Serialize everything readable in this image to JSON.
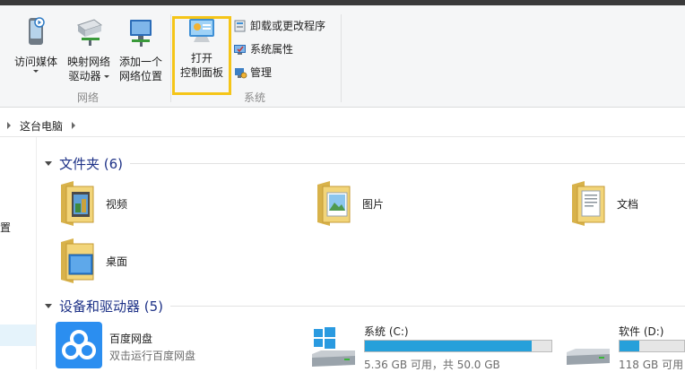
{
  "ribbon": {
    "network_group": {
      "label": "网络",
      "buttons": [
        {
          "label_line1": "访问媒体",
          "label_line2": ""
        },
        {
          "label_line1": "映射网络",
          "label_line2": "驱动器"
        },
        {
          "label_line1": "添加一个",
          "label_line2": "网络位置"
        }
      ]
    },
    "system_group": {
      "label": "系统",
      "open_control_panel": {
        "line1": "打开",
        "line2": "控制面板"
      },
      "uninstall": "卸载或更改程序",
      "system_properties": "系统属性",
      "manage": "管理"
    },
    "highlight_color": "#f5c518"
  },
  "address": {
    "crumb": "这台电脑"
  },
  "nav": {
    "partial_label": "置"
  },
  "folders": {
    "header": "文件夹 (6)",
    "items": [
      {
        "name": "视频",
        "icon": "videos-folder-icon"
      },
      {
        "name": "图片",
        "icon": "pictures-folder-icon"
      },
      {
        "name": "文档",
        "icon": "documents-folder-icon"
      },
      {
        "name": "桌面",
        "icon": "desktop-folder-icon"
      }
    ]
  },
  "devices": {
    "header": "设备和驱动器 (5)",
    "items": [
      {
        "name": "百度网盘",
        "sub": "双击运行百度网盘",
        "icon": "baidu-netdisk-icon"
      },
      {
        "name": "系统 (C:)",
        "free": "5.36 GB 可用，共 50.0 GB",
        "used_fraction": 0.893,
        "icon": "windows-drive-icon"
      },
      {
        "name": "软件 (D:)",
        "free": "118 GB 可用",
        "used_fraction": 0.3,
        "icon": "hard-drive-icon"
      }
    ]
  },
  "colors": {
    "accent": "#26a0da",
    "header_text": "#1e3287"
  }
}
